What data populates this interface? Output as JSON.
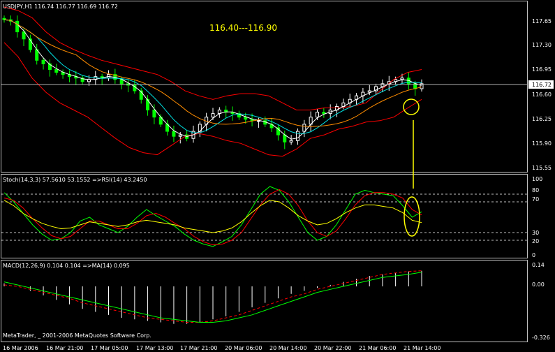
{
  "header": {
    "symbol_line": "USDJPY,H1  116.74 116.77 116.69 116.72",
    "annotation": "116.40---116.90"
  },
  "price_panel": {
    "y_ticks": [
      "117.65",
      "117.30",
      "116.95",
      "116.60",
      "116.25",
      "115.90",
      "115.55"
    ],
    "current_price": "116.72"
  },
  "stoch_panel": {
    "title": "Stoch(14,3,3) 57.5610 53.1552  =>RSI(14) 43.2450",
    "y_ticks": [
      "100",
      "80",
      "70",
      "30",
      "20",
      "0"
    ]
  },
  "macd_panel": {
    "title": "MACD(12,26,9) 0.104 0.104  =>MA(14) 0.095",
    "y_ticks": [
      "0.14",
      "0.00",
      "-0.326"
    ]
  },
  "footer": {
    "copyright": "MetaTrader, _ 2001-2006 MetaQuotes Software Corp."
  },
  "x_ticks": [
    "16 Mar 2006",
    "16 Mar 21:00",
    "17 Mar 05:00",
    "17 Mar 13:00",
    "17 Mar 21:00",
    "20 Mar 06:00",
    "20 Mar 14:00",
    "20 Mar 22:00",
    "21 Mar 06:00",
    "21 Mar 14:00"
  ],
  "colors": {
    "background": "#000000",
    "grid": "#c0c0c0",
    "candle_up": "#ffffff",
    "candle_down": "#00ff00",
    "bollinger": "#ff0000",
    "ma_fast": "#ffffff",
    "ma_mid": "#00e0e0",
    "ma_slow": "#ff8c00",
    "stoch_main": "#00ff00",
    "stoch_signal": "#ff0000",
    "rsi": "#ffff00",
    "annotation": "#ffff00",
    "macd_hist": "#ffffff",
    "macd_signal": "#ff0000",
    "macd_ma": "#00ff00"
  },
  "chart_data": [
    {
      "type": "candlestick",
      "title": "USDJPY,H1",
      "ylim": [
        115.5,
        117.8
      ],
      "series": [
        {
          "name": "close",
          "values": [
            117.62,
            117.6,
            117.45,
            117.35,
            117.2,
            117.05,
            117.0,
            116.92,
            116.88,
            116.85,
            116.82,
            116.8,
            116.75,
            116.78,
            116.82,
            116.8,
            116.85,
            116.78,
            116.72,
            116.7,
            116.62,
            116.5,
            116.35,
            116.25,
            116.15,
            116.05,
            115.98,
            116.0,
            115.95,
            116.05,
            116.15,
            116.25,
            116.3,
            116.35,
            116.32,
            116.3,
            116.25,
            116.22,
            116.2,
            116.2,
            116.15,
            116.1,
            116.0,
            115.9,
            115.92,
            116.05,
            116.15,
            116.25,
            116.32,
            116.3,
            116.35,
            116.4,
            116.45,
            116.5,
            116.55,
            116.6,
            116.62,
            116.68,
            116.72,
            116.75,
            116.78,
            116.8,
            116.72,
            116.65,
            116.72
          ]
        }
      ],
      "bollinger_upper": [
        117.8,
        117.75,
        117.65,
        117.45,
        117.3,
        117.2,
        117.12,
        117.05,
        117.0,
        116.95,
        116.9,
        116.85,
        116.75,
        116.62,
        116.55,
        116.5,
        116.55,
        116.58,
        116.58,
        116.55,
        116.45,
        116.35,
        116.35,
        116.38,
        116.38,
        116.4,
        116.45,
        116.62,
        116.78,
        116.88,
        116.92
      ],
      "bollinger_lower": [
        117.3,
        117.1,
        116.8,
        116.6,
        116.45,
        116.35,
        116.25,
        116.1,
        115.95,
        115.82,
        115.75,
        115.72,
        115.85,
        115.98,
        116.02,
        115.98,
        115.92,
        115.88,
        115.8,
        115.72,
        115.7,
        115.8,
        115.95,
        116.0,
        116.08,
        116.12,
        116.18,
        116.2,
        116.25,
        116.38,
        116.5
      ],
      "current_price": 116.72,
      "annotation": "116.40---116.90"
    },
    {
      "type": "line",
      "title": "Stoch(14,3,3) 57.5610 53.1552  =>RSI(14) 43.2450",
      "ylim": [
        0,
        100
      ],
      "series": [
        {
          "name": "Stoch main",
          "values": [
            82,
            70,
            55,
            40,
            28,
            20,
            22,
            30,
            45,
            50,
            40,
            35,
            30,
            38,
            50,
            60,
            52,
            45,
            38,
            28,
            20,
            15,
            12,
            18,
            25,
            40,
            60,
            80,
            90,
            85,
            70,
            50,
            30,
            20,
            25,
            40,
            60,
            80,
            85,
            82,
            80,
            78,
            65,
            50,
            57
          ]
        },
        {
          "name": "Stoch signal",
          "values": [
            75,
            72,
            62,
            48,
            36,
            26,
            22,
            25,
            35,
            45,
            45,
            40,
            35,
            35,
            42,
            52,
            55,
            50,
            42,
            35,
            25,
            18,
            14,
            15,
            20,
            30,
            48,
            66,
            80,
            86,
            80,
            65,
            45,
            30,
            25,
            32,
            48,
            66,
            78,
            82,
            82,
            80,
            75,
            60,
            53
          ]
        },
        {
          "name": "RSI",
          "values": [
            72,
            65,
            55,
            48,
            42,
            38,
            35,
            36,
            40,
            44,
            42,
            40,
            38,
            40,
            44,
            46,
            44,
            42,
            40,
            36,
            34,
            32,
            30,
            32,
            36,
            44,
            55,
            65,
            72,
            70,
            62,
            52,
            45,
            40,
            42,
            48,
            56,
            62,
            66,
            66,
            64,
            62,
            56,
            46,
            43
          ]
        }
      ],
      "levels": [
        80,
        70,
        30,
        20
      ]
    },
    {
      "type": "bar",
      "title": "MACD(12,26,9) 0.104 0.104  =>MA(14) 0.095",
      "ylim": [
        -0.326,
        0.14
      ],
      "series": [
        {
          "name": "MACD",
          "values": [
            0.02,
            0.0,
            -0.03,
            -0.06,
            -0.09,
            -0.12,
            -0.15,
            -0.17,
            -0.19,
            -0.21,
            -0.22,
            -0.23,
            -0.24,
            -0.25,
            -0.25,
            -0.24,
            -0.22,
            -0.2,
            -0.17,
            -0.14,
            -0.11,
            -0.08,
            -0.05,
            -0.03,
            -0.01,
            0.01,
            0.03,
            0.05,
            0.07,
            0.08,
            0.09,
            0.1,
            0.104
          ]
        },
        {
          "name": "Signal",
          "values": [
            0.01,
            0.0,
            -0.02,
            -0.04,
            -0.06,
            -0.08,
            -0.11,
            -0.13,
            -0.15,
            -0.17,
            -0.19,
            -0.21,
            -0.22,
            -0.23,
            -0.24,
            -0.24,
            -0.23,
            -0.21,
            -0.19,
            -0.16,
            -0.13,
            -0.1,
            -0.07,
            -0.05,
            -0.02,
            0.0,
            0.02,
            0.04,
            0.06,
            0.08,
            0.09,
            0.1,
            0.104
          ]
        },
        {
          "name": "MA(14)",
          "values": [
            0.03,
            0.01,
            -0.01,
            -0.03,
            -0.05,
            -0.07,
            -0.09,
            -0.11,
            -0.13,
            -0.15,
            -0.17,
            -0.19,
            -0.21,
            -0.22,
            -0.23,
            -0.24,
            -0.24,
            -0.23,
            -0.21,
            -0.19,
            -0.16,
            -0.13,
            -0.1,
            -0.07,
            -0.04,
            -0.02,
            0.0,
            0.02,
            0.04,
            0.06,
            0.07,
            0.08,
            0.095
          ]
        }
      ]
    }
  ]
}
